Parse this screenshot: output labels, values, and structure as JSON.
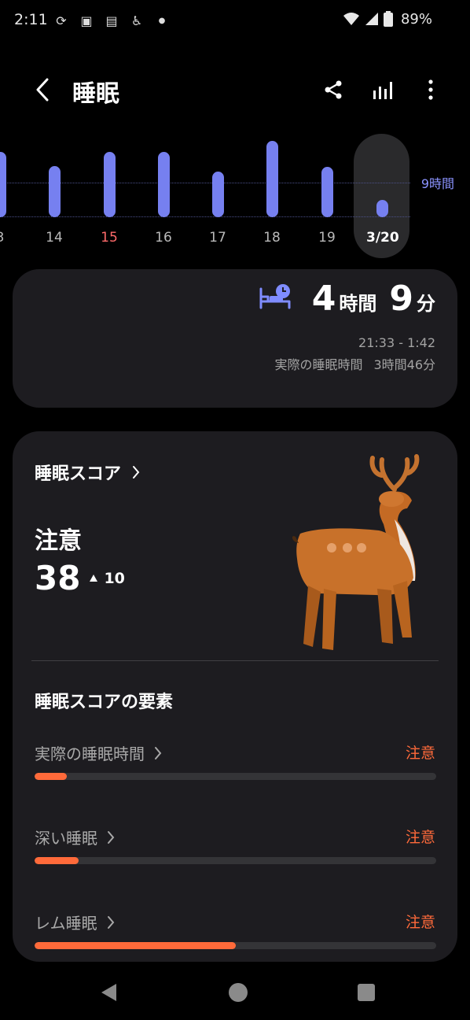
{
  "status_bar": {
    "time": "2:11",
    "battery": "89%"
  },
  "header": {
    "title": "睡眠"
  },
  "week": {
    "hours_label": "9時間",
    "days": [
      {
        "label": "3",
        "hours": 5.7,
        "color": "#b9b9b9"
      },
      {
        "label": "14",
        "hours": 4.5,
        "color": "#b9b9b9"
      },
      {
        "label": "15",
        "hours": 5.7,
        "color": "#ff6a6a"
      },
      {
        "label": "16",
        "hours": 5.7,
        "color": "#b9b9b9"
      },
      {
        "label": "17",
        "hours": 4.0,
        "color": "#b9b9b9"
      },
      {
        "label": "18",
        "hours": 6.7,
        "color": "#b9b9b9"
      },
      {
        "label": "19",
        "hours": 4.4,
        "color": "#b9b9b9"
      },
      {
        "label": "3/20",
        "hours": 1.5,
        "selected": true
      }
    ]
  },
  "summary": {
    "hours_num": "4",
    "hours_unit": "時間",
    "minutes_num": "9",
    "minutes_unit": "分",
    "range": "21:33 - 1:42",
    "actual_label": "実際の睡眠時間",
    "actual_value": "3時間46分"
  },
  "score": {
    "link_label": "睡眠スコア",
    "status": "注意",
    "value": "38",
    "delta": "10",
    "factors_title": "睡眠スコアの要素",
    "factors": [
      {
        "name": "実際の睡眠時間",
        "status": "注意",
        "progress": 0.08
      },
      {
        "name": "深い睡眠",
        "status": "注意",
        "progress": 0.11
      },
      {
        "name": "レム睡眠",
        "status": "注意",
        "progress": 0.5
      }
    ]
  },
  "colors": {
    "accent": "#7680f0",
    "warning": "#ff6a3a",
    "card": "#1d1c20"
  }
}
